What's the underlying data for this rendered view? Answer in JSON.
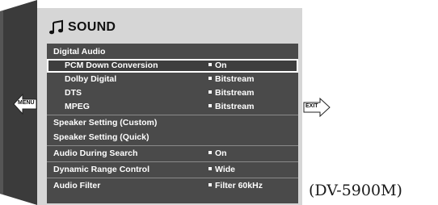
{
  "screen": {
    "title": "SOUND",
    "title_icon": "music-note-icon"
  },
  "menu": {
    "rows": [
      {
        "label": "Digital Audio",
        "value": ""
      },
      {
        "label": "PCM Down Conversion",
        "value": "On"
      },
      {
        "label": "Dolby Digital",
        "value": "Bitstream"
      },
      {
        "label": "DTS",
        "value": "Bitstream"
      },
      {
        "label": "MPEG",
        "value": "Bitstream"
      },
      {
        "label": "Speaker Setting (Custom)",
        "value": ""
      },
      {
        "label": "Speaker Setting (Quick)",
        "value": ""
      },
      {
        "label": "Audio  During Search",
        "value": "On"
      },
      {
        "label": "Dynamic Range Control",
        "value": "Wide"
      },
      {
        "label": "Audio  Filter",
        "value": "Filter 60kHz"
      }
    ],
    "selected_index": 1
  },
  "nav": {
    "menu_label": "MENU",
    "exit_label": "EXIT"
  },
  "caption": "(DV-5900M)",
  "colors": {
    "screen_bg": "#d6d6d6",
    "panel_bg": "#4a4a4a",
    "side_panel": "#3a3a3a",
    "text_light": "#ffffff"
  }
}
